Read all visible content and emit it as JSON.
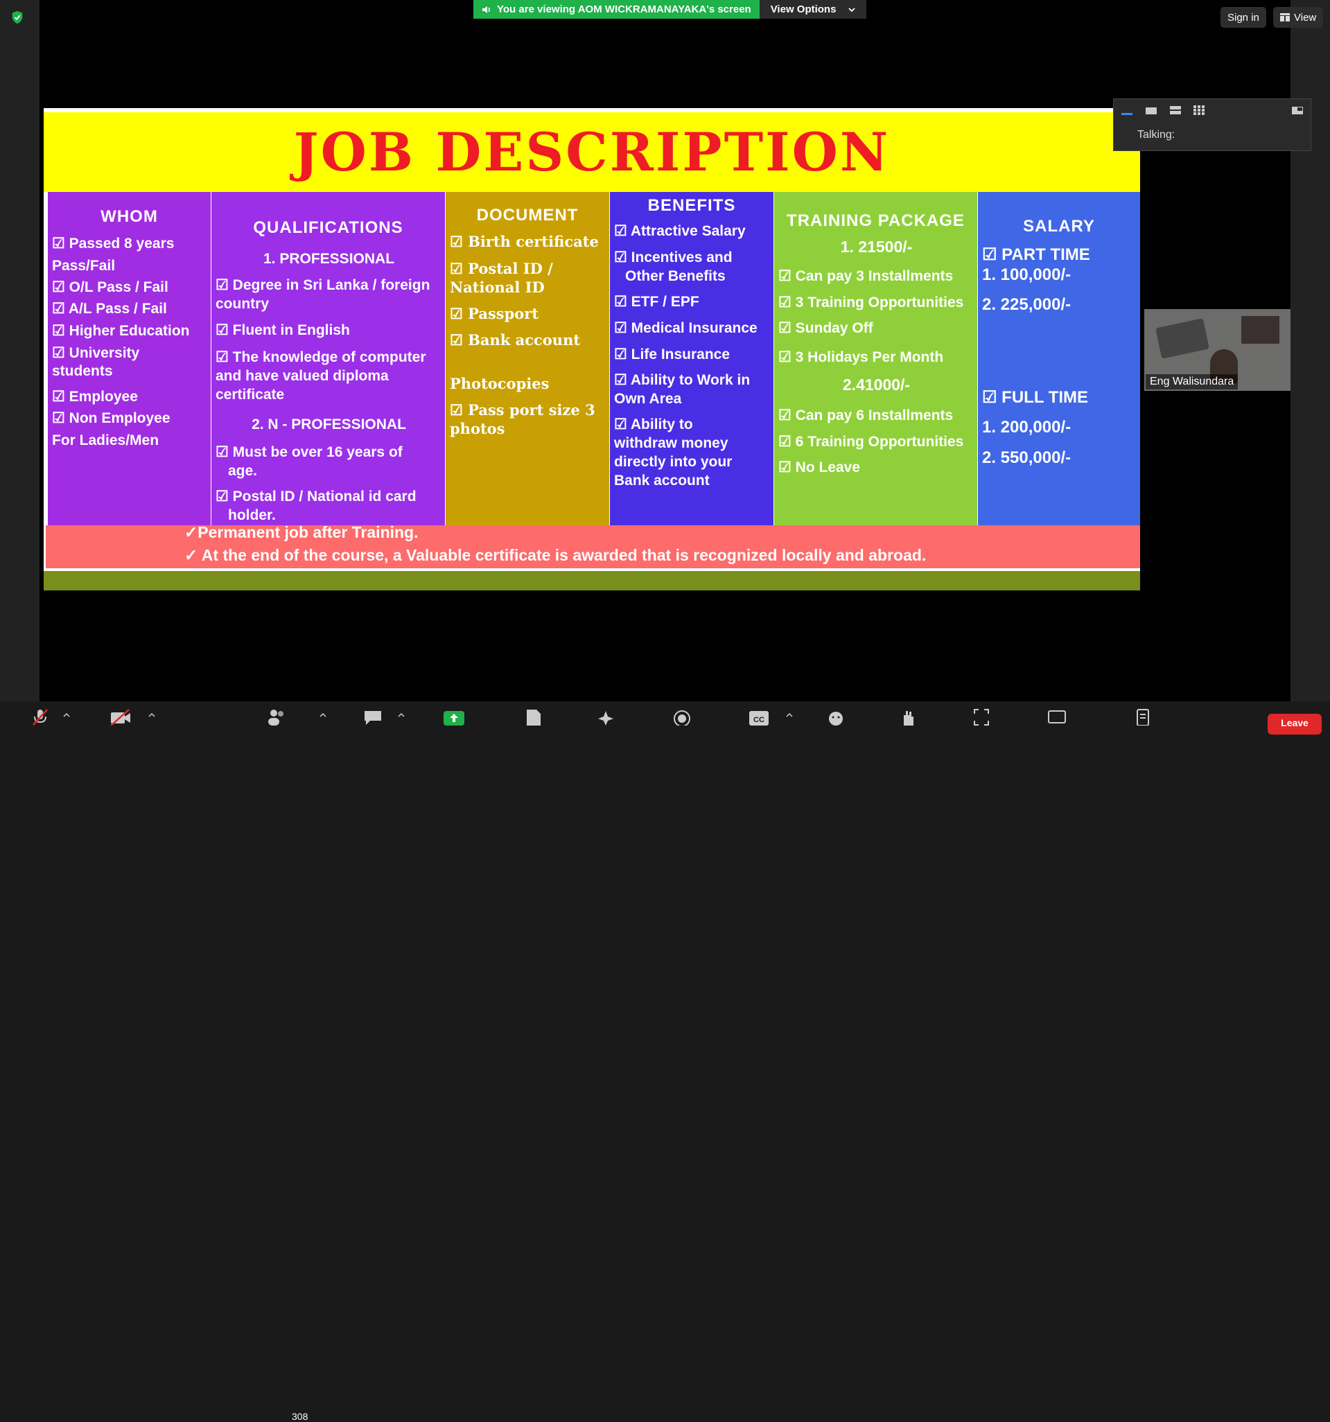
{
  "window": {
    "banner_text": "You are viewing AOM WICKRAMANAYAKA's screen",
    "view_options": "View Options",
    "sign_in": "Sign in",
    "view": "View"
  },
  "slide": {
    "title": "JOB DESCRIPTION",
    "whom": {
      "header": "WHOM",
      "items": [
        "☑ Passed 8 years",
        "Pass/Fail",
        "☑ O/L Pass / Fail",
        "☑ A/L Pass / Fail",
        "☑ Higher Education",
        "☑ University",
        "students",
        "☑ Employee",
        "☑  Non Employee",
        "For  Ladies/Men"
      ]
    },
    "qualifications": {
      "header": "QUALIFICATIONS",
      "sub1": "1. PROFESSIONAL",
      "items1": [
        "☑ Degree in Sri Lanka / foreign",
        "country",
        "☑  Fluent in English",
        "☑  The knowledge of computer",
        "and have valued diploma",
        "certificate"
      ],
      "sub2": "2. N -  PROFESSIONAL",
      "items2": [
        "☑ Must be over 16    years of",
        "age.",
        "☑  Postal ID / National id card",
        "holder."
      ]
    },
    "document": {
      "header": "DOCUMENT",
      "items": [
        "☑ Birth certificate",
        "☑ Postal ID /",
        "National ID",
        "☑ Passport",
        "☑ Bank account"
      ],
      "sub": "Photocopies",
      "items2": [
        "☑ Pass port size 3",
        "photos"
      ]
    },
    "benefits": {
      "header": "BENEFITS",
      "items": [
        "☑ Attractive Salary",
        "☑ Incentives and",
        "Other Benefits",
        "☑ ETF / EPF",
        "☑ Medical Insurance",
        "☑ Life Insurance",
        "☑ Ability to Work in",
        "Own Area",
        "☑ Ability to",
        "withdraw money",
        "directly into your",
        "Bank account"
      ]
    },
    "training": {
      "header": "TRAINING PACKAGE",
      "price1": "1. 21500/-",
      "items1": [
        "☑ Can pay 3 Installments",
        "☑ 3 Training Opportunities",
        "☑  Sunday Off",
        "☑ 3 Holidays Per Month"
      ],
      "price2": "2.41000/-",
      "items2": [
        "☑ Can pay 6 Installments",
        "☑ 6 Training Opportunities",
        "☑ No Leave"
      ]
    },
    "salary": {
      "header": "SALARY",
      "part_time": "☑ PART TIME",
      "pt_values": [
        "1. 100,000/-",
        "2. 225,000/-"
      ],
      "full_time": "☑ FULL TIME",
      "ft_values": [
        "1. 200,000/-",
        "2. 550,000/-"
      ]
    },
    "footer": [
      "✓Permanent job  after Training.",
      "✓ At the end of the course, a Valuable certificate is awarded that is recognized locally and abroad."
    ]
  },
  "participants_panel": {
    "talking": "Talking:"
  },
  "video_tile": {
    "name": "Eng  Walisundara"
  },
  "toolbar": {
    "participant_count": "308",
    "cc_label": "CC",
    "leave": "Leave"
  },
  "colors": {
    "banner_green": "#1fb14a",
    "leave_red": "#e02828",
    "title_red": "#ee1c24",
    "title_yellow": "#ffff00"
  }
}
